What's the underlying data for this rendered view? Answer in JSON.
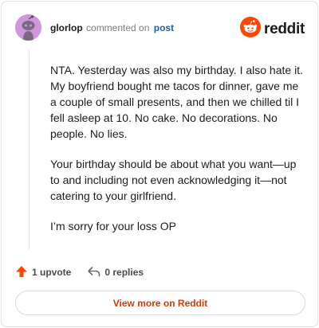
{
  "header": {
    "username": "glorlop",
    "action_text": "commented on",
    "post_link": "post",
    "brand": "reddit"
  },
  "comment": {
    "paragraphs": [
      "NTA. Yesterday was also my birthday. I also hate it. My boyfriend bought me tacos for dinner, gave me a couple of small presents, and then we chilled til I fell asleep at 10. No cake. No decorations. No people. No lies.",
      "Your birthday should be about what you want—up to and including not even acknowledging it—not catering to your girlfriend.",
      "I’m sorry for your loss OP"
    ]
  },
  "actions": {
    "upvote_label": "1 upvote",
    "replies_label": "0 replies"
  },
  "footer": {
    "view_more_label": "View more on Reddit"
  },
  "colors": {
    "brand_orange": "#ff4500",
    "link_blue": "#1a5faa",
    "view_more_text": "#d93900",
    "avatar_bg": "#cf96de"
  },
  "icons": [
    "snoo-avatar-icon",
    "reddit-logo-icon",
    "upvote-arrow-icon",
    "reply-icon"
  ]
}
